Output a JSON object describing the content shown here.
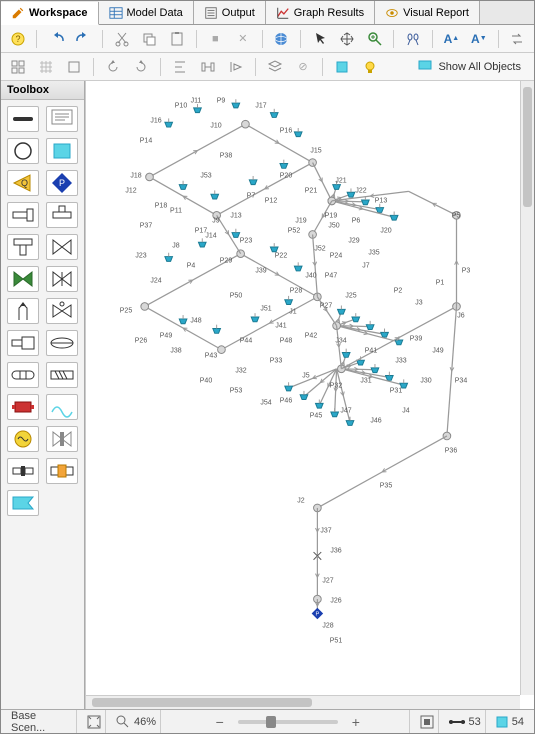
{
  "tabs": [
    {
      "label": "Workspace",
      "icon": "pencil",
      "active": true
    },
    {
      "label": "Model Data",
      "icon": "table",
      "active": false
    },
    {
      "label": "Output",
      "icon": "output",
      "active": false
    },
    {
      "label": "Graph Results",
      "icon": "chart",
      "active": false
    },
    {
      "label": "Visual Report",
      "icon": "eye",
      "active": false
    }
  ],
  "toolbar_row2": {
    "show_all_label": "Show All Objects"
  },
  "toolbox": {
    "title": "Toolbox",
    "tools": [
      "pipe",
      "annotation",
      "reservoir-circle",
      "reservoir-rect",
      "assigned-flow",
      "assigned-pressure",
      "branch",
      "tee",
      "tee-alt",
      "valve",
      "check-valve",
      "valve2",
      "relief-valve",
      "control-valve",
      "area-change",
      "area-change2",
      "bend",
      "screen",
      "pump",
      "compressor",
      "heat-exchanger",
      "orifice",
      "spray",
      "separator",
      "dead-end"
    ]
  },
  "zoom_pct": "46%",
  "scenario": "Base Scen...",
  "pipe_count": "53",
  "jct_count": "54",
  "colors": {
    "accent": "#2aa7c8",
    "diamond": "#1a3fb0",
    "node": "#bcbcbc",
    "line": "#9a9a9a"
  },
  "canvas_labels": [
    "J11",
    "J16",
    "P10",
    "P9",
    "J17",
    "P14",
    "J10",
    "P16",
    "J15",
    "J18",
    "P11",
    "J9",
    "P7",
    "P20",
    "P21",
    "J21",
    "J22",
    "P13",
    "J12",
    "P18",
    "P17",
    "J13",
    "P12",
    "J19",
    "P19",
    "P6",
    "J20",
    "J23",
    "J8",
    "J14",
    "P23",
    "P22",
    "J40",
    "P24",
    "J7",
    "P5",
    "P25",
    "J24",
    "P4",
    "P29",
    "J39",
    "P28",
    "P27",
    "J25",
    "J6",
    "P26",
    "J38",
    "P43",
    "P44",
    "J41",
    "P42",
    "J34",
    "P41",
    "J33",
    "P40",
    "J32",
    "P33",
    "J5",
    "P32",
    "J31",
    "P31",
    "J30",
    "P34",
    "P46",
    "P45",
    "J47",
    "J46",
    "J4",
    "P36",
    "P35",
    "J37",
    "J36",
    "J27",
    "J26",
    "J28",
    "P51",
    "P50",
    "J51",
    "P52",
    "J52",
    "J53",
    "P38",
    "P37",
    "P48",
    "P49",
    "J48",
    "J50",
    "J29",
    "J35",
    "P47",
    "P3",
    "P39",
    "J49",
    "P53",
    "J54",
    "P2",
    "J3",
    "J2",
    "P1",
    "J1"
  ]
}
